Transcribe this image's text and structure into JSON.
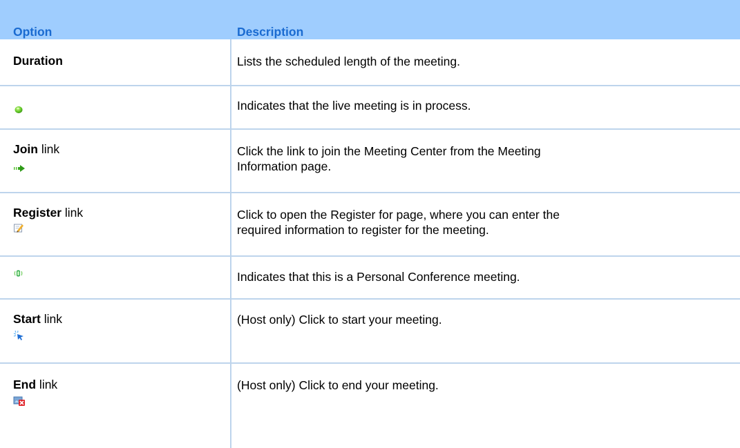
{
  "header": {
    "option": "Option",
    "description": "Description"
  },
  "rows": [
    {
      "option_bold": "Duration",
      "option_suffix": "",
      "icon": null,
      "description": "Lists the scheduled length of the meeting."
    },
    {
      "option_bold": "",
      "option_suffix": "",
      "icon": "in-progress-icon",
      "description": "Indicates that the live meeting is in process."
    },
    {
      "option_bold": "Join",
      "option_suffix": " link",
      "icon": "join-arrow-icon",
      "description_line1": "Click the link to join the Meeting Center from the Meeting",
      "description_line2": "Information page."
    },
    {
      "option_bold": "Register",
      "option_suffix": " link",
      "icon": "register-edit-icon",
      "description_line1": "Click to open the Register for page, where you can enter the",
      "description_line2": "required information to register for the meeting."
    },
    {
      "option_bold": "",
      "option_suffix": "",
      "icon": "personal-conference-icon",
      "description": "Indicates that this is a Personal Conference meeting."
    },
    {
      "option_bold": "Start",
      "option_suffix": " link",
      "icon": "start-cursor-icon",
      "description": "(Host only) Click to start your meeting."
    },
    {
      "option_bold": "End",
      "option_suffix": " link",
      "icon": "end-close-icon",
      "description": "(Host only) Click to end your meeting."
    }
  ],
  "colors": {
    "header_bg": "#9fcdfe",
    "header_text": "#1a6bd1",
    "grid_line": "#bdd4ec"
  }
}
